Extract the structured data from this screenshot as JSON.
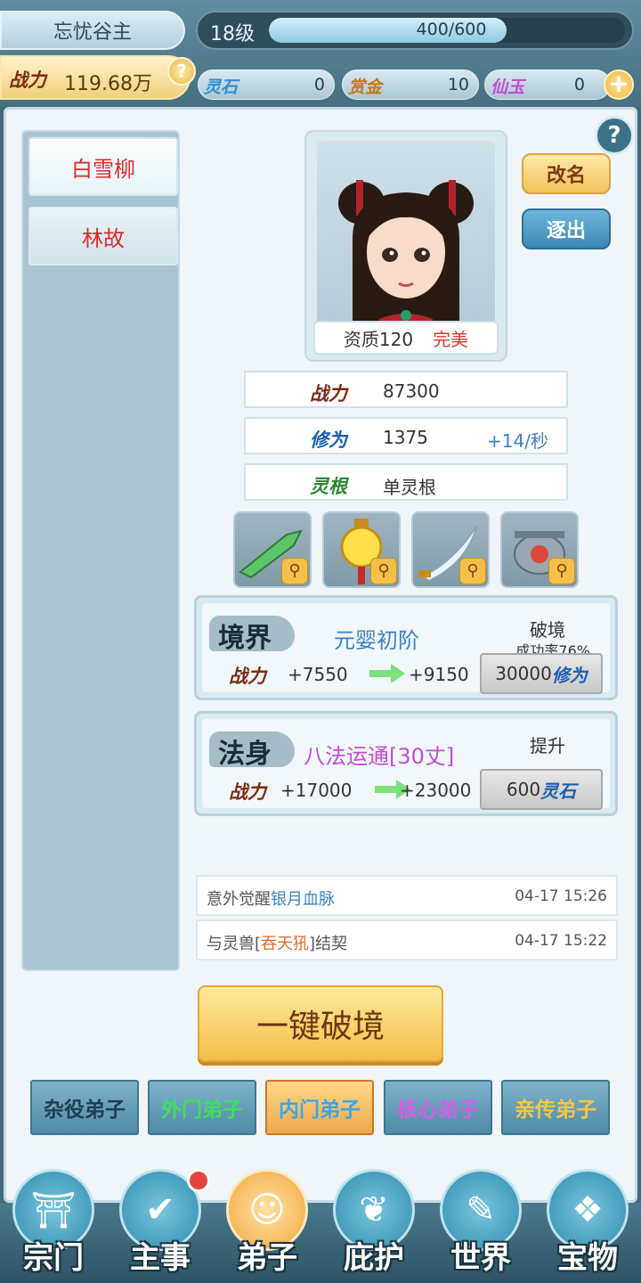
{
  "header": {
    "player_name": "忘忧谷主",
    "level": "18级",
    "exp_text": "400/600",
    "exp_fraction": 0.667,
    "power_label": "战力",
    "power_value": "119.68万",
    "help": "?",
    "currencies": [
      {
        "label": "灵石",
        "value": "0",
        "color": "#2f8fd3"
      },
      {
        "label": "赏金",
        "value": "10",
        "color": "#c47a12"
      },
      {
        "label": "仙玉",
        "value": "0",
        "color": "#c34bd6"
      }
    ],
    "plus": "+"
  },
  "disciples": [
    {
      "name": "白雪柳",
      "active": true
    },
    {
      "name": "林故",
      "active": false
    }
  ],
  "detail": {
    "help": "?",
    "aptitude_label": "资质120",
    "aptitude_grade": "完美",
    "rename_label": "改名",
    "expel_label": "逐出",
    "stats": [
      {
        "label": "战力",
        "value": "87300",
        "extra": "",
        "color": "#7a2b12"
      },
      {
        "label": "修为",
        "value": "1375",
        "extra": "+14/秒",
        "color": "#1b5fb0"
      },
      {
        "label": "灵根",
        "value": "单灵根",
        "extra": "",
        "color": "#2a8a2a"
      }
    ],
    "equipment": [
      "jade-blade-icon",
      "golden-lantern-icon",
      "curved-saber-icon",
      "cauldron-icon"
    ],
    "realm": {
      "title": "境界",
      "name": "元婴初阶",
      "power_label": "战力",
      "from": "+7550",
      "to": "+9150",
      "right_title": "破境",
      "rate": "成功率76%",
      "action_num": "30000",
      "action_unit": "修为"
    },
    "body": {
      "title": "法身",
      "name": "八法运通[30丈]",
      "power_label": "战力",
      "from": "+17000",
      "to": "+23000",
      "right_title": "提升",
      "action_num": "600",
      "action_unit": "灵石"
    },
    "logs": [
      {
        "prefix": "意外觉醒",
        "highlight": "银月血脉",
        "suffix": "",
        "time": "04-17 15:26"
      },
      {
        "prefix": "与灵兽[",
        "highlight": "吞天犼",
        "suffix": "]结契",
        "time": "04-17 15:22"
      }
    ],
    "break_button": "一键破境"
  },
  "ranks": [
    {
      "label": "杂役弟子",
      "color": "#1f3f52",
      "active": false
    },
    {
      "label": "外门弟子",
      "color": "#3ee05e",
      "active": false
    },
    {
      "label": "内门弟子",
      "color": "#3aa6e6",
      "active": true
    },
    {
      "label": "核心弟子",
      "color": "#d85ee8",
      "active": false
    },
    {
      "label": "亲传弟子",
      "color": "#f5c642",
      "active": false
    }
  ],
  "nav": [
    {
      "label": "宗门",
      "icon": "sect-icon",
      "glyph": "⛩",
      "active": false,
      "dot": false
    },
    {
      "label": "主事",
      "icon": "task-icon",
      "glyph": "✔",
      "active": false,
      "dot": true
    },
    {
      "label": "弟子",
      "icon": "disciple-icon",
      "glyph": "☺",
      "active": true,
      "dot": false
    },
    {
      "label": "庇护",
      "icon": "shelter-icon",
      "glyph": "❦",
      "active": false,
      "dot": false
    },
    {
      "label": "世界",
      "icon": "world-icon",
      "glyph": "✎",
      "active": false,
      "dot": false
    },
    {
      "label": "宝物",
      "icon": "treasure-icon",
      "glyph": "❖",
      "active": false,
      "dot": false
    }
  ]
}
